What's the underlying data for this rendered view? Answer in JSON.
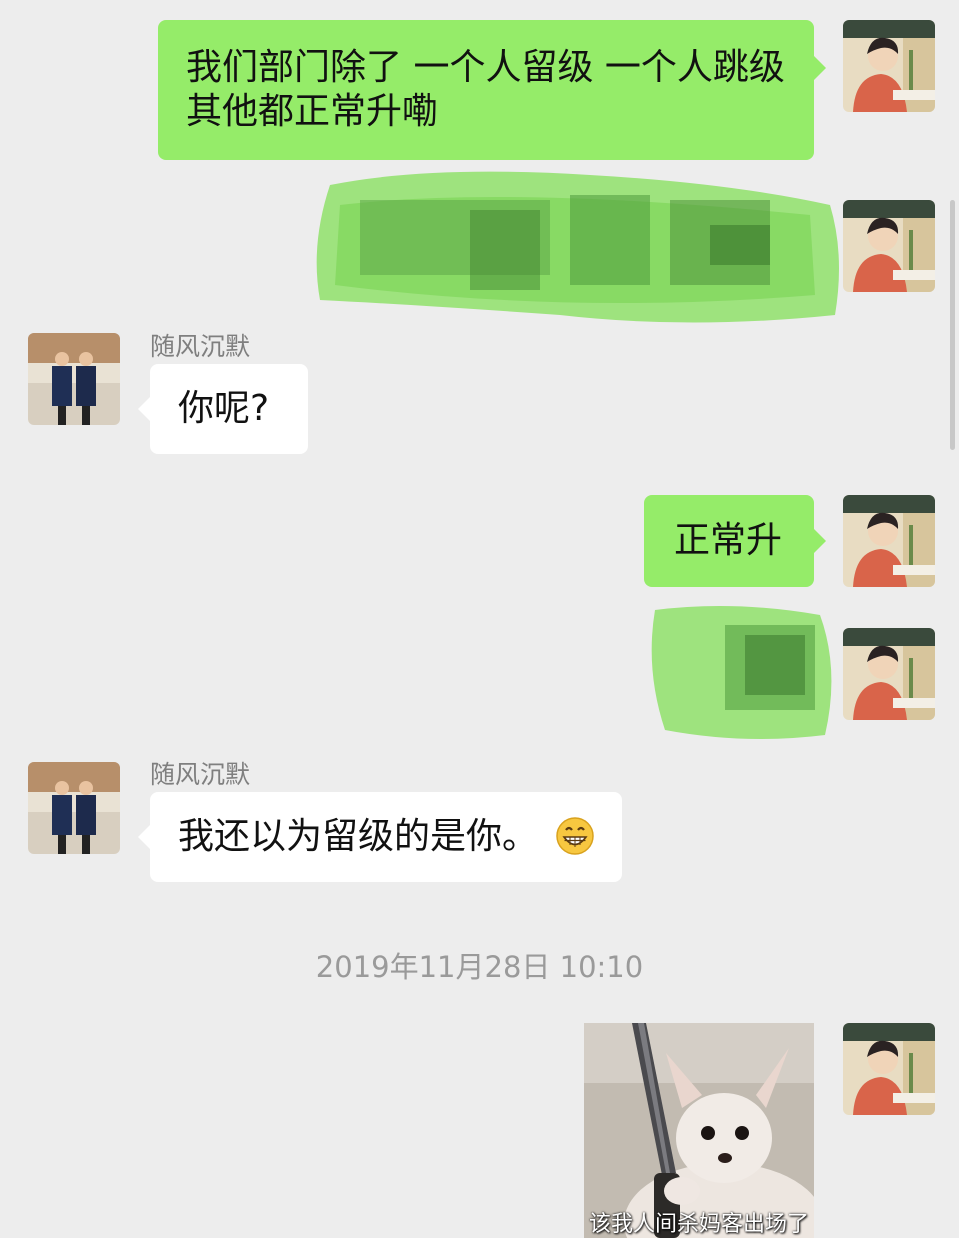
{
  "messages": {
    "m1_text": "我们部门除了 一个人留级  一个人跳级  其他都正常升嘞",
    "m3_sender": "随风沉默",
    "m3_text": "你呢?",
    "m4_text": "正常升",
    "m6_sender": "随风沉默",
    "m6_text": "我还以为留级的是你。",
    "timestamp": "2019年11月28日 10:10",
    "sticker_caption": "该我人间杀妈客出场了"
  },
  "colors": {
    "background": "#ededed",
    "my_bubble": "#95ec69",
    "other_bubble": "#ffffff",
    "name_text": "#7f7f7f",
    "timestamp_text": "#9a9a9a"
  },
  "icons": {
    "emoji": "grinning-face-emoji"
  }
}
